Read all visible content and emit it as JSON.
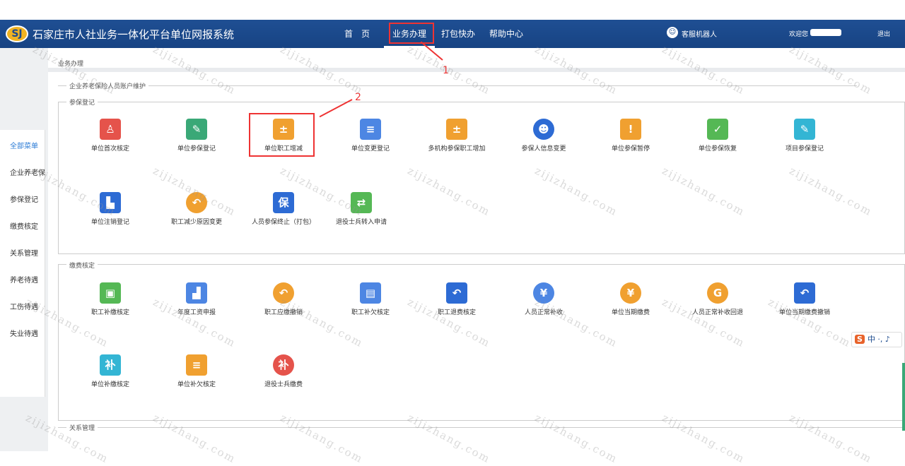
{
  "header": {
    "app_title": "石家庄市人社业务一体化平台单位网报系统",
    "nav": [
      "首　页",
      "业务办理",
      "打包快办",
      "帮助中心"
    ],
    "robot_label": "客服机器人",
    "welcome": "欢迎您",
    "logout": "退出"
  },
  "sidebar": {
    "items": [
      "全部菜单",
      "企业养老保",
      "参保登记",
      "缴费核定",
      "关系管理",
      "养老待遇",
      "工伤待遇",
      "失业待遇"
    ]
  },
  "breadcrumb": "业务办理",
  "sections": {
    "account": "企业养老保险人员账户维护",
    "register": "参保登记",
    "payment": "缴费核定",
    "relation": "关系管理"
  },
  "register_row1": [
    "单位首次核定",
    "单位参保登记",
    "单位职工增减",
    "单位变更登记",
    "多机构参保职工增加",
    "参保人信息变更",
    "单位参保暂停",
    "单位参保恢复",
    "项目参保登记"
  ],
  "register_row2": [
    "单位注销登记",
    "职工减少原因变更",
    "人员参保终止（打包）",
    "退役士兵转入申请"
  ],
  "payment_row1": [
    "职工补缴核定",
    "年度工资申报",
    "职工应缴撤销",
    "职工补欠核定",
    "职工退费核定",
    "人员正常补收",
    "单位当期缴费",
    "人员正常补收回退",
    "单位当期缴费撤销"
  ],
  "payment_row2": [
    "单位补缴核定",
    "单位补欠核定",
    "退役士兵缴费"
  ],
  "annotations": [
    "1",
    "2"
  ],
  "ime": {
    "logo": "S",
    "text": "中 ·, ♪"
  },
  "watermark": "zijizhang.com"
}
